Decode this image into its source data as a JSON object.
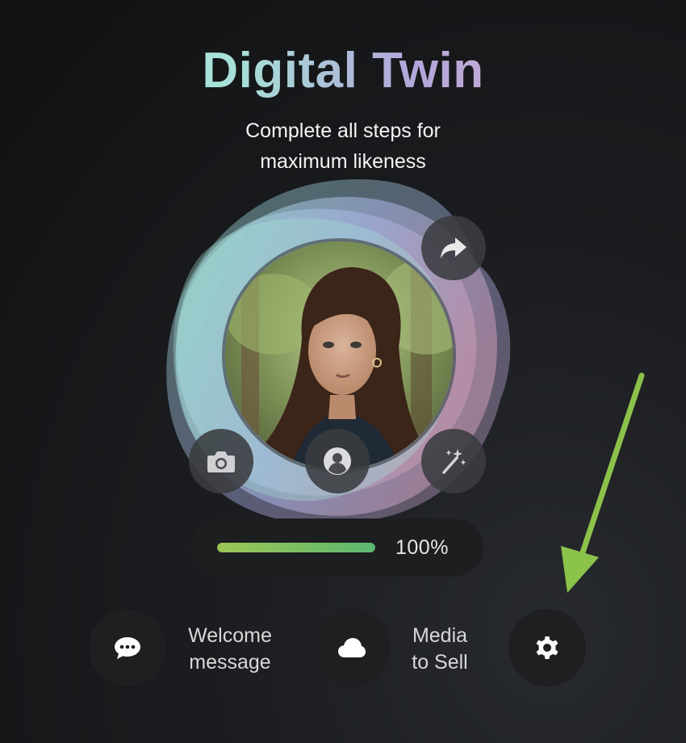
{
  "header": {
    "title": "Digital Twin",
    "subtitle_line1": "Complete all steps for",
    "subtitle_line2": "maximum likeness"
  },
  "avatar": {
    "icons": {
      "share": "share-arrow-icon",
      "camera": "camera-icon",
      "profile": "user-circle-icon",
      "magic": "magic-wand-icon"
    }
  },
  "progress": {
    "value": 1.0,
    "label": "100%"
  },
  "actions": [
    {
      "line1": "Welcome",
      "line2": "message",
      "icon": "chat-bubble-icon"
    },
    {
      "line1": "Media",
      "line2": "to Sell",
      "icon": "cloud-icon"
    },
    {
      "icon": "gear-icon"
    }
  ],
  "colors": {
    "background": "#151618",
    "title_gradient_start": "#b8f3e6",
    "title_gradient_end": "#e7b3c9",
    "progress_fill_start": "#9cc655",
    "progress_fill_end": "#5cb870",
    "arrow": "#8bc34a"
  }
}
